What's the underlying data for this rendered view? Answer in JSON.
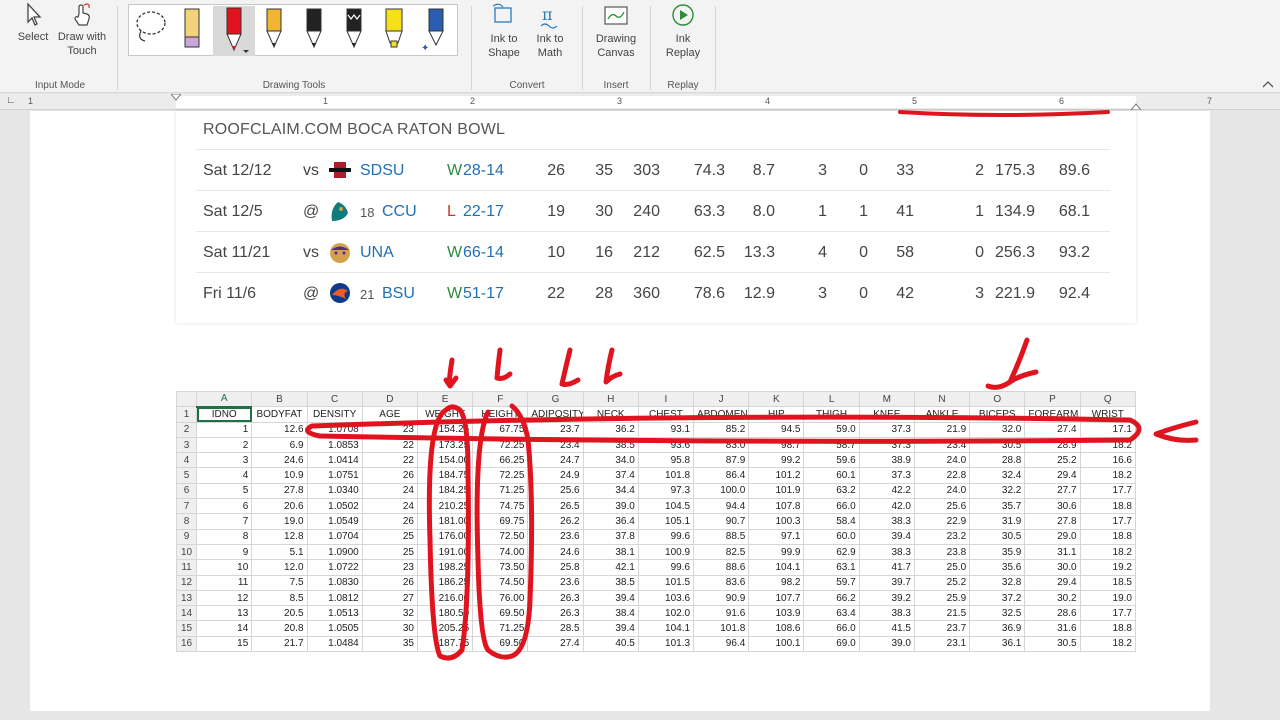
{
  "ribbon": {
    "input_mode": {
      "select_label": "Select",
      "touch_label": "Draw with Touch",
      "group_label": "Input Mode"
    },
    "drawing_tools": {
      "group_label": "Drawing Tools"
    },
    "convert": {
      "shape_label": "Ink to Shape",
      "math_label": "Ink to Math",
      "group_label": "Convert"
    },
    "insert": {
      "canvas_label": "Drawing Canvas",
      "group_label": "Insert"
    },
    "replay": {
      "replay_label": "Ink Replay",
      "group_label": "Replay"
    }
  },
  "ruler": {
    "marks": [
      "1",
      "1",
      "2",
      "3",
      "4",
      "5",
      "6",
      "7"
    ]
  },
  "game_card": {
    "title": "ROOFCLAIM.COM BOCA RATON BOWL",
    "rows": [
      {
        "date": "Sat 12/12",
        "loc": "vs",
        "rank": "",
        "opp": "SDSU",
        "res": "W",
        "score": "28-14",
        "s": [
          "26",
          "35",
          "303",
          "74.3",
          "8.7",
          "3",
          "0",
          "33",
          "2",
          "175.3",
          "89.6"
        ]
      },
      {
        "date": "Sat 12/5",
        "loc": "@",
        "rank": "18",
        "opp": "CCU",
        "res": "L",
        "score": "22-17",
        "s": [
          "19",
          "30",
          "240",
          "63.3",
          "8.0",
          "1",
          "1",
          "41",
          "1",
          "134.9",
          "68.1"
        ]
      },
      {
        "date": "Sat 11/21",
        "loc": "vs",
        "rank": "",
        "opp": "UNA",
        "res": "W",
        "score": "66-14",
        "s": [
          "10",
          "16",
          "212",
          "62.5",
          "13.3",
          "4",
          "0",
          "58",
          "0",
          "256.3",
          "93.2"
        ]
      },
      {
        "date": "Fri 11/6",
        "loc": "@",
        "rank": "21",
        "opp": "BSU",
        "res": "W",
        "score": "51-17",
        "s": [
          "22",
          "28",
          "360",
          "78.6",
          "12.9",
          "3",
          "0",
          "42",
          "3",
          "221.9",
          "92.4"
        ]
      }
    ],
    "colors": {
      "win": "#2e8b3d",
      "loss": "#c0392b",
      "team": "#1f6fb8"
    }
  },
  "sheet": {
    "columns": [
      "A",
      "B",
      "C",
      "D",
      "E",
      "F",
      "G",
      "H",
      "I",
      "J",
      "K",
      "L",
      "M",
      "N",
      "O",
      "P",
      "Q"
    ],
    "headers": [
      "IDNO",
      "BODYFAT",
      "DENSITY",
      "AGE",
      "WEIGHT",
      "HEIGHT",
      "ADIPOSITY",
      "NECK",
      "CHEST",
      "ABDOMEN",
      "HIP",
      "THIGH",
      "KNEE",
      "ANKLE",
      "BICEPS",
      "FOREARM",
      "WRIST"
    ],
    "rows": [
      [
        "1",
        "12.6",
        "1.0708",
        "23",
        "154.25",
        "67.75",
        "23.7",
        "36.2",
        "93.1",
        "85.2",
        "94.5",
        "59.0",
        "37.3",
        "21.9",
        "32.0",
        "27.4",
        "17.1"
      ],
      [
        "2",
        "6.9",
        "1.0853",
        "22",
        "173.25",
        "72.25",
        "23.4",
        "38.5",
        "93.6",
        "83.0",
        "98.7",
        "58.7",
        "37.3",
        "23.4",
        "30.5",
        "28.9",
        "18.2"
      ],
      [
        "3",
        "24.6",
        "1.0414",
        "22",
        "154.00",
        "66.25",
        "24.7",
        "34.0",
        "95.8",
        "87.9",
        "99.2",
        "59.6",
        "38.9",
        "24.0",
        "28.8",
        "25.2",
        "16.6"
      ],
      [
        "4",
        "10.9",
        "1.0751",
        "26",
        "184.75",
        "72.25",
        "24.9",
        "37.4",
        "101.8",
        "86.4",
        "101.2",
        "60.1",
        "37.3",
        "22.8",
        "32.4",
        "29.4",
        "18.2"
      ],
      [
        "5",
        "27.8",
        "1.0340",
        "24",
        "184.25",
        "71.25",
        "25.6",
        "34.4",
        "97.3",
        "100.0",
        "101.9",
        "63.2",
        "42.2",
        "24.0",
        "32.2",
        "27.7",
        "17.7"
      ],
      [
        "6",
        "20.6",
        "1.0502",
        "24",
        "210.25",
        "74.75",
        "26.5",
        "39.0",
        "104.5",
        "94.4",
        "107.8",
        "66.0",
        "42.0",
        "25.6",
        "35.7",
        "30.6",
        "18.8"
      ],
      [
        "7",
        "19.0",
        "1.0549",
        "26",
        "181.00",
        "69.75",
        "26.2",
        "36.4",
        "105.1",
        "90.7",
        "100.3",
        "58.4",
        "38.3",
        "22.9",
        "31.9",
        "27.8",
        "17.7"
      ],
      [
        "8",
        "12.8",
        "1.0704",
        "25",
        "176.00",
        "72.50",
        "23.6",
        "37.8",
        "99.6",
        "88.5",
        "97.1",
        "60.0",
        "39.4",
        "23.2",
        "30.5",
        "29.0",
        "18.8"
      ],
      [
        "9",
        "5.1",
        "1.0900",
        "25",
        "191.00",
        "74.00",
        "24.6",
        "38.1",
        "100.9",
        "82.5",
        "99.9",
        "62.9",
        "38.3",
        "23.8",
        "35.9",
        "31.1",
        "18.2"
      ],
      [
        "10",
        "12.0",
        "1.0722",
        "23",
        "198.25",
        "73.50",
        "25.8",
        "42.1",
        "99.6",
        "88.6",
        "104.1",
        "63.1",
        "41.7",
        "25.0",
        "35.6",
        "30.0",
        "19.2"
      ],
      [
        "11",
        "7.5",
        "1.0830",
        "26",
        "186.25",
        "74.50",
        "23.6",
        "38.5",
        "101.5",
        "83.6",
        "98.2",
        "59.7",
        "39.7",
        "25.2",
        "32.8",
        "29.4",
        "18.5"
      ],
      [
        "12",
        "8.5",
        "1.0812",
        "27",
        "216.00",
        "76.00",
        "26.3",
        "39.4",
        "103.6",
        "90.9",
        "107.7",
        "66.2",
        "39.2",
        "25.9",
        "37.2",
        "30.2",
        "19.0"
      ],
      [
        "13",
        "20.5",
        "1.0513",
        "32",
        "180.50",
        "69.50",
        "26.3",
        "38.4",
        "102.0",
        "91.6",
        "103.9",
        "63.4",
        "38.3",
        "21.5",
        "32.5",
        "28.6",
        "17.7"
      ],
      [
        "14",
        "20.8",
        "1.0505",
        "30",
        "205.25",
        "71.25",
        "28.5",
        "39.4",
        "104.1",
        "101.8",
        "108.6",
        "66.0",
        "41.5",
        "23.7",
        "36.9",
        "31.6",
        "18.8"
      ],
      [
        "15",
        "21.7",
        "1.0484",
        "35",
        "187.75",
        "69.50",
        "27.4",
        "40.5",
        "101.3",
        "96.4",
        "100.1",
        "69.0",
        "39.0",
        "23.1",
        "36.1",
        "30.5",
        "18.2"
      ]
    ]
  },
  "ink_color": "#e0141e"
}
